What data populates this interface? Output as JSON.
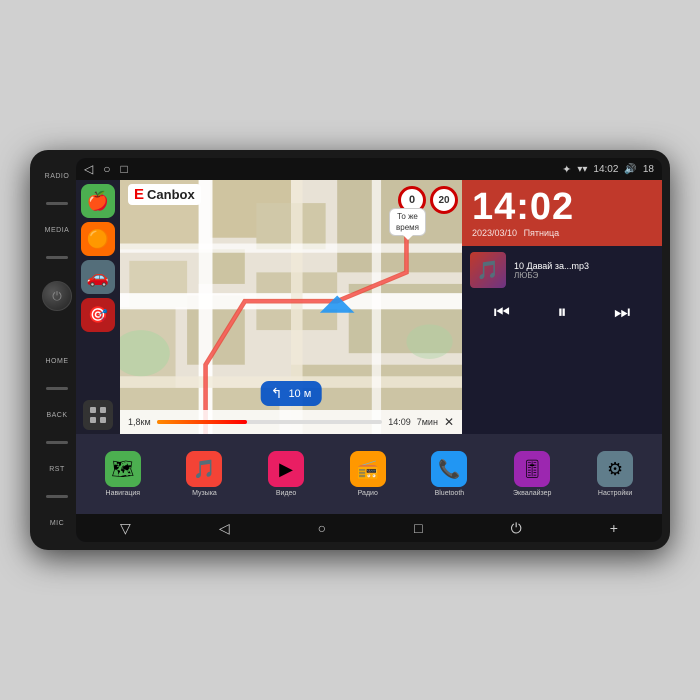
{
  "device": {
    "brand": "Canbox",
    "brand_prefix": "E"
  },
  "status_bar": {
    "nav_back": "◁",
    "nav_home": "○",
    "nav_square": "□",
    "time": "14:02",
    "battery": "18",
    "bluetooth_icon": "bluetooth",
    "wifi_icon": "wifi"
  },
  "map": {
    "speed_current": "0",
    "speed_limit": "20",
    "tooltip_line1": "То же",
    "tooltip_line2": "время",
    "instruction_distance": "10 м",
    "dist_remaining": "1,8км",
    "eta": "14:09",
    "time_remaining": "7мин",
    "progress": "40"
  },
  "clock": {
    "time": "14:02",
    "date": "2023/03/10",
    "weekday": "Пятница"
  },
  "music": {
    "track": "10 Давай за...mp3",
    "artist": "ЛЮБЭ",
    "prev_btn": "⏮",
    "play_btn": "⏸",
    "next_btn": "⏭"
  },
  "apps": [
    {
      "name": "nav-app",
      "icon": "🗺",
      "label": "Навигация",
      "bg": "#4caf50"
    },
    {
      "name": "music-app",
      "icon": "🎵",
      "label": "Музыка",
      "bg": "#f44336"
    },
    {
      "name": "video-app",
      "icon": "▶",
      "label": "Видео",
      "bg": "#e91e63"
    },
    {
      "name": "radio-app",
      "icon": "📻",
      "label": "Радио",
      "bg": "#ff9800"
    },
    {
      "name": "bluetooth-app",
      "icon": "📞",
      "label": "Bluetooth",
      "bg": "#2196f3"
    },
    {
      "name": "eq-app",
      "icon": "🎚",
      "label": "Эквалайзер",
      "bg": "#9c27b0"
    },
    {
      "name": "settings-app",
      "icon": "⚙",
      "label": "Настройки",
      "bg": "#607d8b"
    }
  ],
  "bottom_nav": [
    "▽",
    "◁",
    "○",
    "□",
    "⏻",
    "+"
  ],
  "side_labels": [
    "RADIO",
    "MEDIA",
    "HOME",
    "BACK",
    "RST",
    "MIC"
  ],
  "left_sidebar_apps": [
    {
      "icon": "🍎",
      "bg": "#4caf50",
      "name": "carplay-icon"
    },
    {
      "icon": "🟠",
      "bg": "#ff6b00",
      "name": "orange-app-icon"
    },
    {
      "icon": "🚗",
      "bg": "#546e7a",
      "name": "car-icon"
    },
    {
      "icon": "🎯",
      "bg": "#b71c1c",
      "name": "target-icon"
    }
  ]
}
